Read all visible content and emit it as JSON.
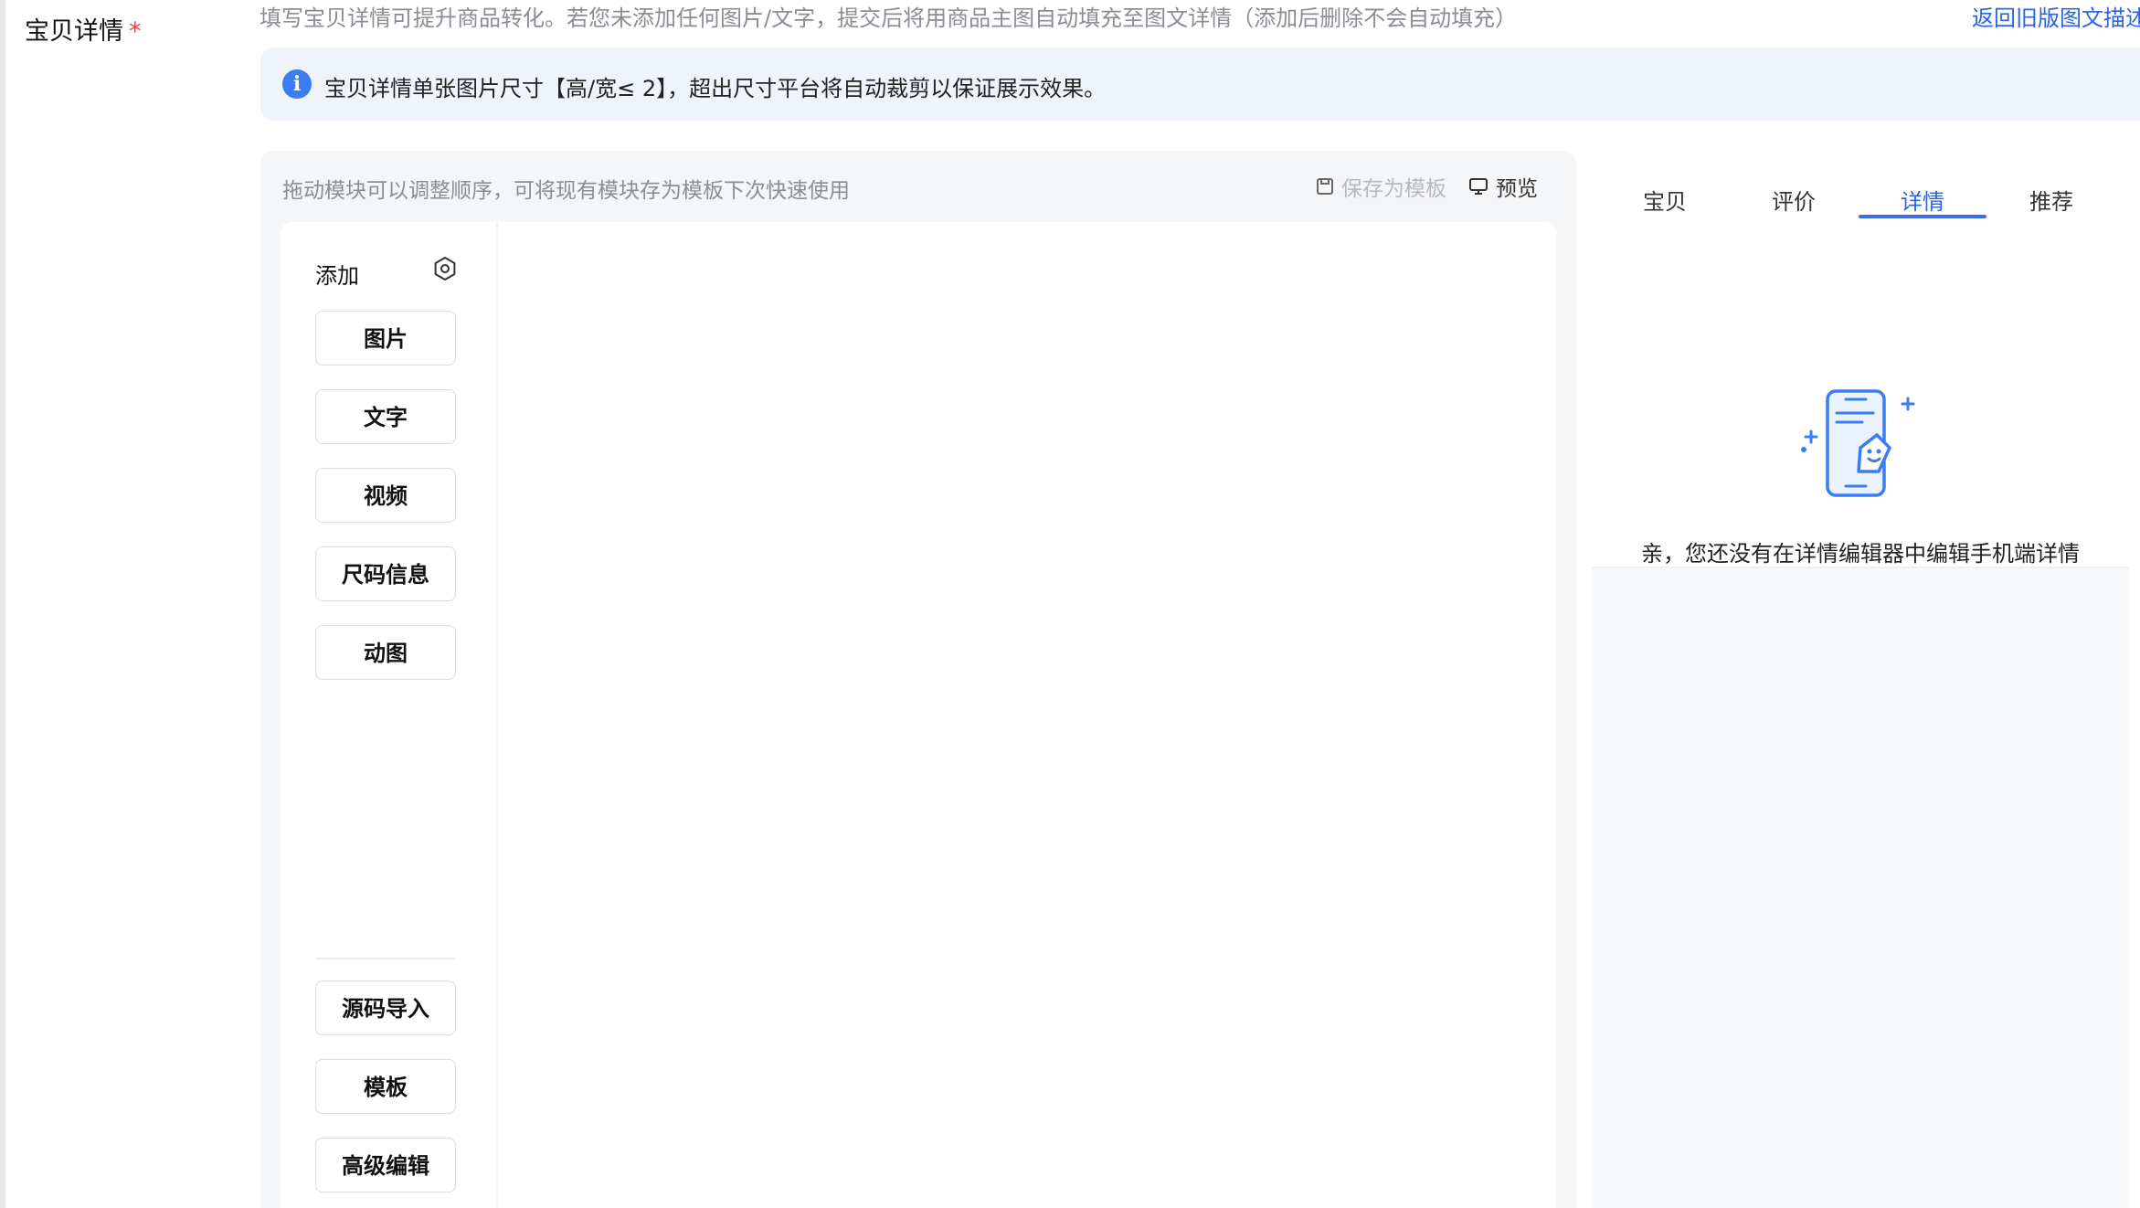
{
  "field": {
    "label": "宝贝详情",
    "required_mark": "*"
  },
  "hint": "填写宝贝详情可提升商品转化。若您未添加任何图片/文字，提交后将用商品主图自动填充至图文详情（添加后删除不会自动填充）",
  "back_link": "返回旧版图文描述",
  "notice": {
    "icon": "info-icon",
    "text": "宝贝详情单张图片尺寸【高/宽≤ 2】，超出尺寸平台将自动裁剪以保证展示效果。"
  },
  "editor": {
    "tip": "拖动模块可以调整顺序，可将现有模块存为模板下次快速使用",
    "save_template": "保存为模板",
    "preview": "预览",
    "add_title": "添加",
    "modules": [
      "图片",
      "文字",
      "视频",
      "尺码信息",
      "动图"
    ],
    "bottom_modules": [
      "源码导入",
      "模板",
      "高级编辑"
    ]
  },
  "preview_panel": {
    "tabs": [
      "宝贝",
      "评价",
      "详情",
      "推荐"
    ],
    "active_tab": "详情",
    "empty_text": "亲，您还没有在详情编辑器中编辑手机端详情"
  },
  "colors": {
    "accent": "#2b63e6",
    "required": "#ff3d3d",
    "notice_bg": "#eef3fc",
    "info_icon": "#3c7cf1"
  }
}
